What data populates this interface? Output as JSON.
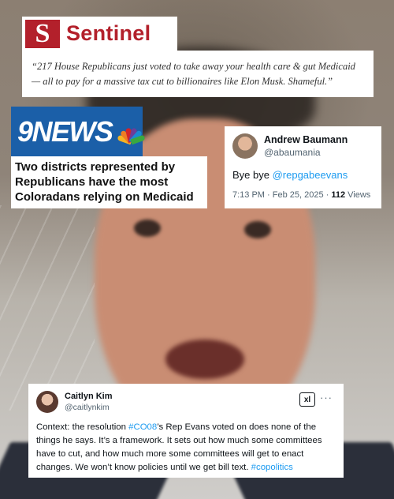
{
  "sentinel": {
    "logo_letter": "S",
    "logo_word": "Sentinel",
    "quote": "“217 House Republicans just voted to take away your health care & gut Medicaid — all to pay for a massive tax cut to billionaires like Elon Musk. Shameful.”"
  },
  "ninenews": {
    "logo_text": "9NEWS",
    "headline": "Two districts represented by Republicans have the most Coloradans relying on Medicaid"
  },
  "tweet_andrew": {
    "name": "Andrew Baumann",
    "handle": "@abaumania",
    "body_prefix": "Bye bye ",
    "body_mention": "@repgabeevans",
    "meta_time": "7:13 PM · Feb 25, 2025 · ",
    "meta_views_count": "112",
    "meta_views_label": " Views"
  },
  "tweet_caitlyn": {
    "name": "Caitlyn Kim",
    "handle": "@caitlynkim",
    "badge_label": "xl",
    "more_label": "···",
    "body_part1": "Context: the resolution ",
    "body_tag1": "#CO08",
    "body_part2": "’s Rep Evans voted on does none of the things he says. It’s a framework. It sets out how much some committees have to cut, and how  much more some committees will get to enact changes. We won’t know policies until we get bill text. ",
    "body_tag2": "#copolitics"
  },
  "colors": {
    "sentinel_red": "#b3202b",
    "ninenews_blue": "#1b5fa8",
    "link_blue": "#1d9bf0"
  }
}
